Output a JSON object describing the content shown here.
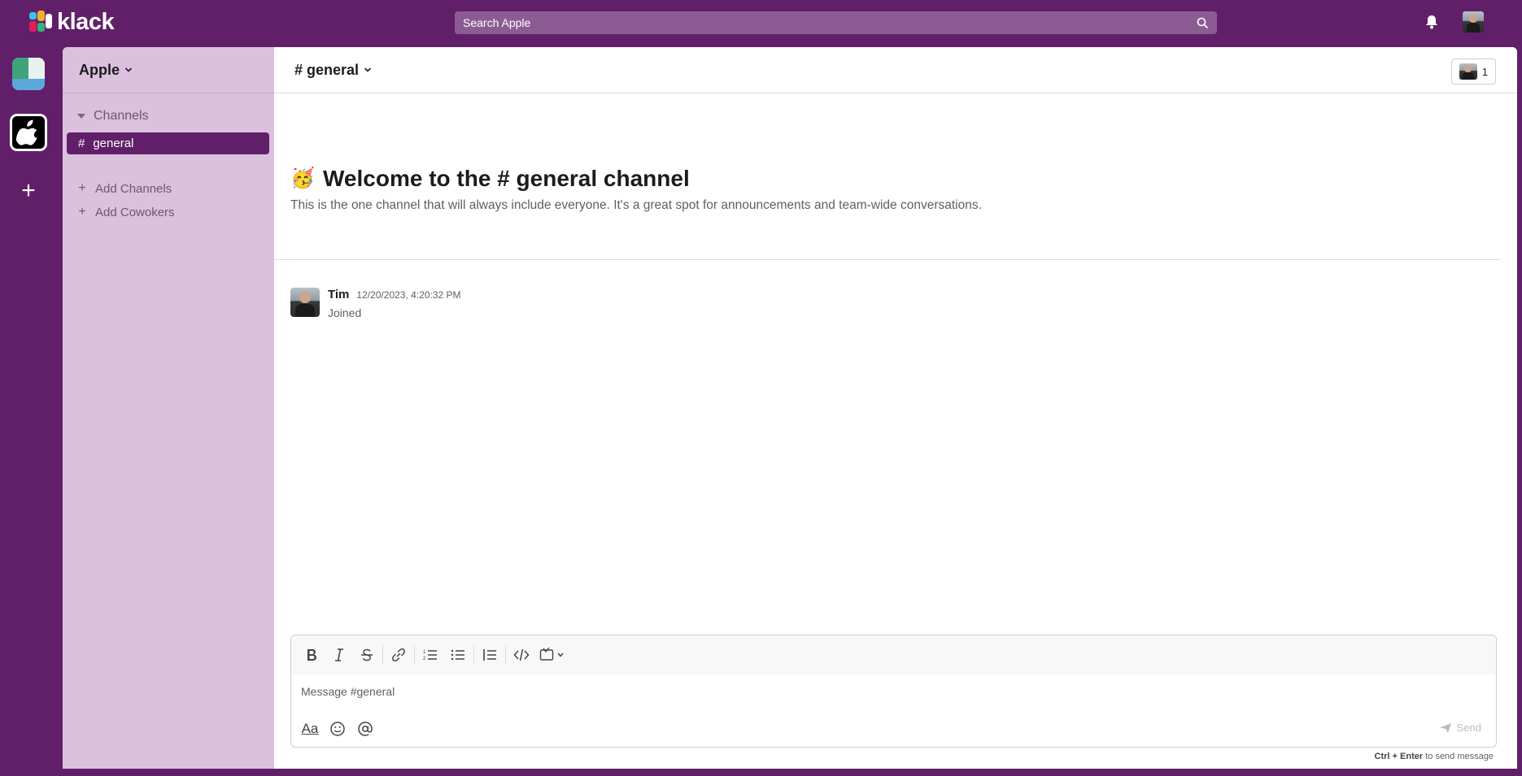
{
  "brand": {
    "name": "klack",
    "accent": "#611f69",
    "sidebar_bg": "#dbc1dd"
  },
  "topbar": {
    "search_placeholder": "Search Apple",
    "search_icon": "search-icon",
    "bell_icon": "bell-icon",
    "avatar_icon": "user-avatar"
  },
  "rail": {
    "workspaces": [
      {
        "name": "workspace-1",
        "icon": "workspace-icon"
      },
      {
        "name": "Apple",
        "icon": "apple-icon",
        "active": true
      }
    ],
    "add_label": "+"
  },
  "sidebar": {
    "workspace_name": "Apple",
    "channels_label": "Channels",
    "channels": [
      {
        "prefix": "#",
        "name": "general",
        "active": true
      }
    ],
    "add_channels_label": "Add Channels",
    "add_cowokers_label": "Add Cowokers"
  },
  "channel": {
    "title": "# general",
    "member_count": "1"
  },
  "welcome": {
    "emoji": "🥳",
    "title": "Welcome to the # general channel",
    "description": "This is the one channel that will always include everyone. It's a great spot for announcements and team-wide conversations."
  },
  "messages": [
    {
      "author": "Tim",
      "time": "12/20/2023, 4:20:32 PM",
      "text": "Joined"
    }
  ],
  "composer": {
    "placeholder": "Message #general",
    "toolbar": [
      "bold-icon",
      "italic-icon",
      "strikethrough-icon",
      "link-icon",
      "ordered-list-icon",
      "bulleted-list-icon",
      "blockquote-icon",
      "code-icon",
      "code-block-icon"
    ],
    "format_label": "Aa",
    "send_label": "Send",
    "hint_keys": "Ctrl + Enter",
    "hint_text": " to send message"
  }
}
